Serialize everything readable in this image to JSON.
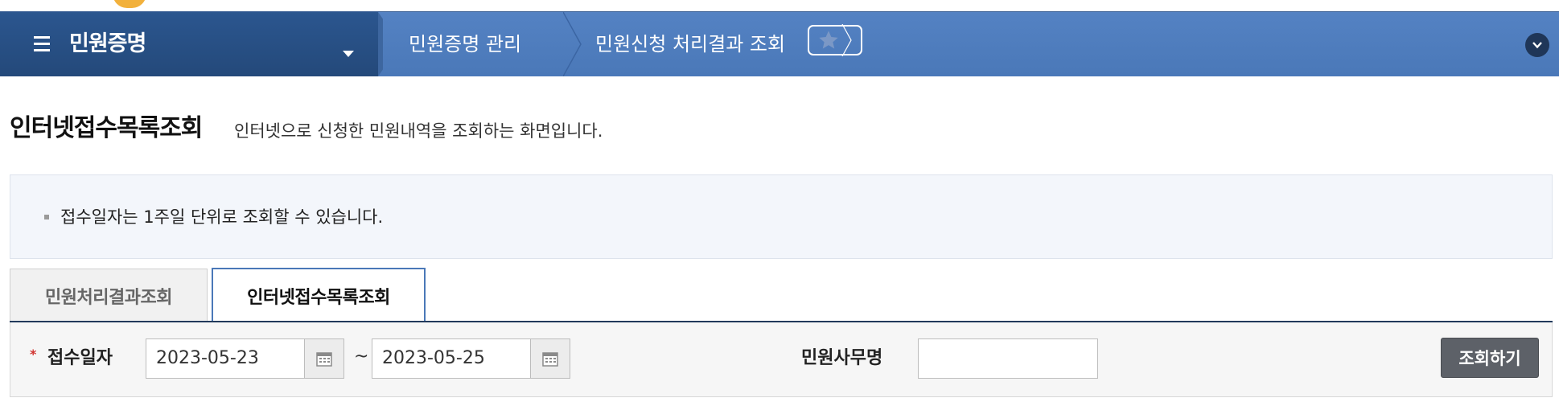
{
  "nav": {
    "home_title": "민원증명",
    "breadcrumbs": [
      {
        "label": "민원증명 관리"
      },
      {
        "label": "민원신청 처리결과 조회"
      }
    ],
    "icons": {
      "menu": "hamburger-menu-icon",
      "favorite": "star-icon",
      "collapse": "chevron-down-circle-icon"
    }
  },
  "page": {
    "title": "인터넷접수목록조회",
    "description": "인터넷으로 신청한 민원내역을 조회하는 화면입니다."
  },
  "notice": {
    "items": [
      "접수일자는 1주일 단위로 조회할 수 있습니다."
    ]
  },
  "tabs": [
    {
      "label": "민원처리결과조회",
      "active": false
    },
    {
      "label": "인터넷접수목록조회",
      "active": true
    }
  ],
  "search": {
    "date_label": "접수일자",
    "required_mark": "*",
    "start_date": "2023-05-23",
    "separator": "~",
    "end_date": "2023-05-25",
    "office_label": "민원사무명",
    "office_value": "",
    "submit_label": "조회하기"
  },
  "colors": {
    "nav_bar": "#4a78b8",
    "nav_home": "#24497a",
    "accent_tab": "#4a78b8",
    "search_button": "#5d6168",
    "required": "#d0312d"
  }
}
